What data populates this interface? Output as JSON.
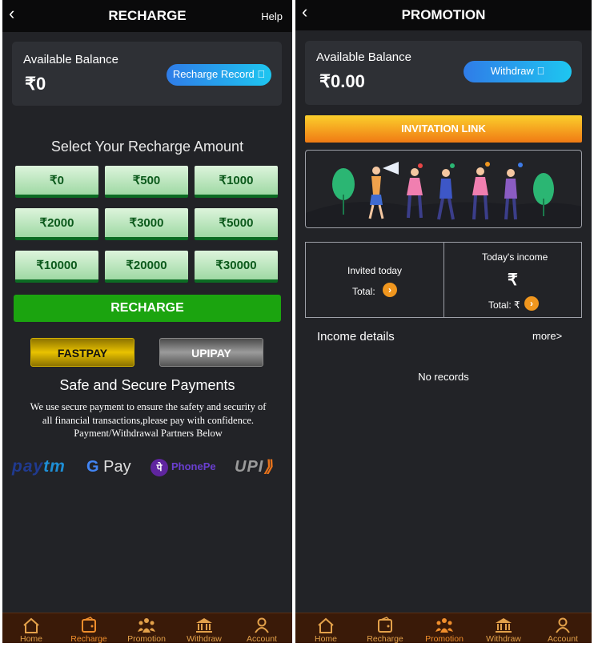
{
  "recharge": {
    "title": "RECHARGE",
    "help": "Help",
    "balance_label": "Available Balance",
    "balance_value": "₹0",
    "record_button": "Recharge Record ⃞",
    "select_title": "Select Your Recharge Amount",
    "amounts": [
      "₹0",
      "₹500",
      "₹1000",
      "₹2000",
      "₹3000",
      "₹5000",
      "₹10000",
      "₹20000",
      "₹30000"
    ],
    "recharge_button": "RECHARGE",
    "fastpay_button": "FASTPAY",
    "upipay_button": "UPIPAY",
    "secure_title": "Safe and Secure Payments",
    "secure_desc_1": "We use secure payment to ensure the safety and security of",
    "secure_desc_2": "all financial transactions,please pay with confidence.",
    "secure_desc_3": "Payment/Withdrawal Partners Below",
    "partners": {
      "paytm_a": "pay",
      "paytm_b": "tm",
      "gpay_g": "G",
      "gpay_rest": " Pay",
      "phonepe_mark": "पे",
      "phonepe_name": "PhonePe",
      "upi_text": "UPI",
      "upi_arrow": "⟫"
    }
  },
  "promotion": {
    "title": "PROMOTION",
    "balance_label": "Available Balance",
    "balance_value": "₹0.00",
    "withdraw_button": "Withdraw ⃞",
    "invitation_button": "INVITATION LINK",
    "invited_today": "Invited today",
    "total_label": "Total:",
    "todays_income": "Today's income",
    "rupee_symbol": "₹",
    "total_income_label": "Total: ₹",
    "income_details": "Income details",
    "more": "more>",
    "no_records": "No records"
  },
  "nav": {
    "items": [
      "Home",
      "Recharge",
      "Promotion",
      "Withdraw",
      "Account"
    ]
  },
  "colors": {
    "background": "#222327",
    "topbar": "#0a0a0b",
    "navbar": "#3a1a08",
    "nav_label": "#e3a14a",
    "recharge_green": "#1ba40f",
    "pill_blue": "#2f7ce8",
    "invite_orange": "#f07a14"
  },
  "icons": [
    "back-chevron-icon",
    "home-icon",
    "wallet-icon",
    "people-icon",
    "bank-icon",
    "user-icon",
    "chevron-right-icon"
  ]
}
